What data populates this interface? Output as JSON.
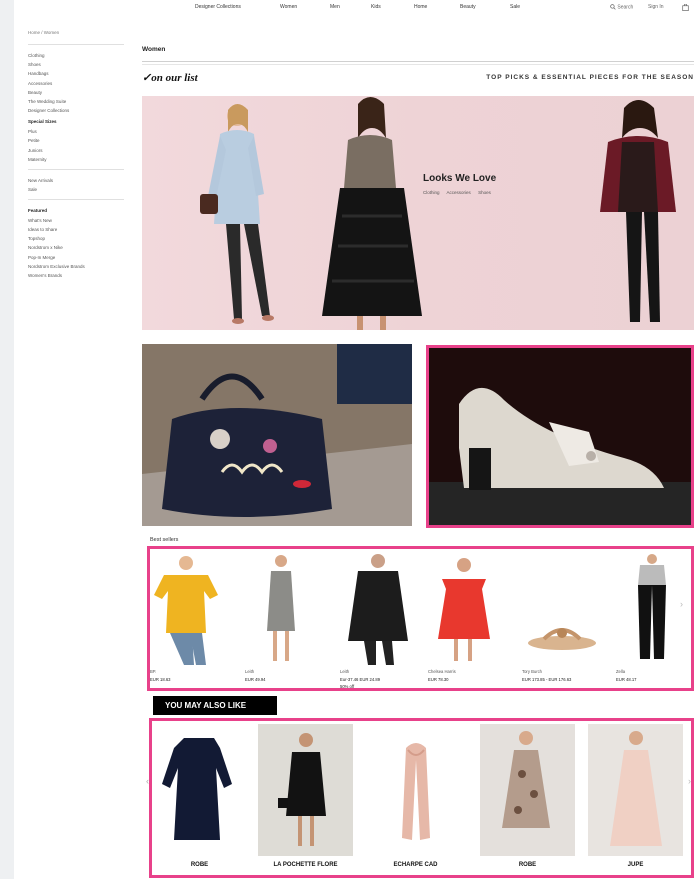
{
  "nav": {
    "items": [
      "Designer Collections",
      "Women",
      "Men",
      "Kids",
      "Home",
      "Beauty",
      "Sale"
    ],
    "search": "Search",
    "sign_in": "Sign In",
    "bag": "0"
  },
  "sidebar": {
    "breadcrumb": "Home / Women",
    "group1": [
      "Clothing",
      "Shoes",
      "Handbags",
      "Accessories",
      "Beauty",
      "The Wedding Suite",
      "Designer Collections"
    ],
    "special_sizes_head": "Special Sizes",
    "group2": [
      "Plus",
      "Petite",
      "Juniors",
      "Maternity"
    ],
    "group3": [
      "New Arrivals",
      "Sale"
    ],
    "featured_head": "Featured",
    "group4": [
      "What's New",
      "Ideas to Share",
      "Topshop",
      "Nordstrom x Nike",
      "Pop-In Merge",
      "Nordstrom Exclusive Brands",
      "Women's Brands"
    ]
  },
  "main": {
    "section_title": "Women",
    "list_logo": "✓on our list",
    "tagline": "TOP PICKS & ESSENTIAL PIECES FOR THE SEASON",
    "hero_title": "Looks We Love",
    "hero_links": [
      "Clothing",
      "Accessories",
      "Shoes"
    ],
    "bestsellers_label": "Best sellers",
    "you_may_also_like": "YOU MAY ALSO LIKE"
  },
  "best_sellers": [
    {
      "brand": "BP.",
      "price": "EUR 18.63"
    },
    {
      "brand": "Leith",
      "price": "EUR 49.94"
    },
    {
      "brand": "Leith",
      "price": "Eur-37.46 EUR 24.89",
      "price2": "50% off"
    },
    {
      "brand": "Chelsea Harris",
      "price": "EUR 78.30"
    },
    {
      "brand": "Tory Burch",
      "price": "EUR 173.85 - EUR 176.63"
    },
    {
      "brand": "Zella",
      "price": "EUR 48.17"
    }
  ],
  "recommendations": [
    {
      "label": "ROBE"
    },
    {
      "label": "LA POCHETTE FLORE"
    },
    {
      "label": "ECHARPE CAD"
    },
    {
      "label": "ROBE"
    },
    {
      "label": "JUPE"
    }
  ],
  "colors": {
    "highlight": "#e8418a",
    "hero_bg": "#f2d9dc"
  }
}
